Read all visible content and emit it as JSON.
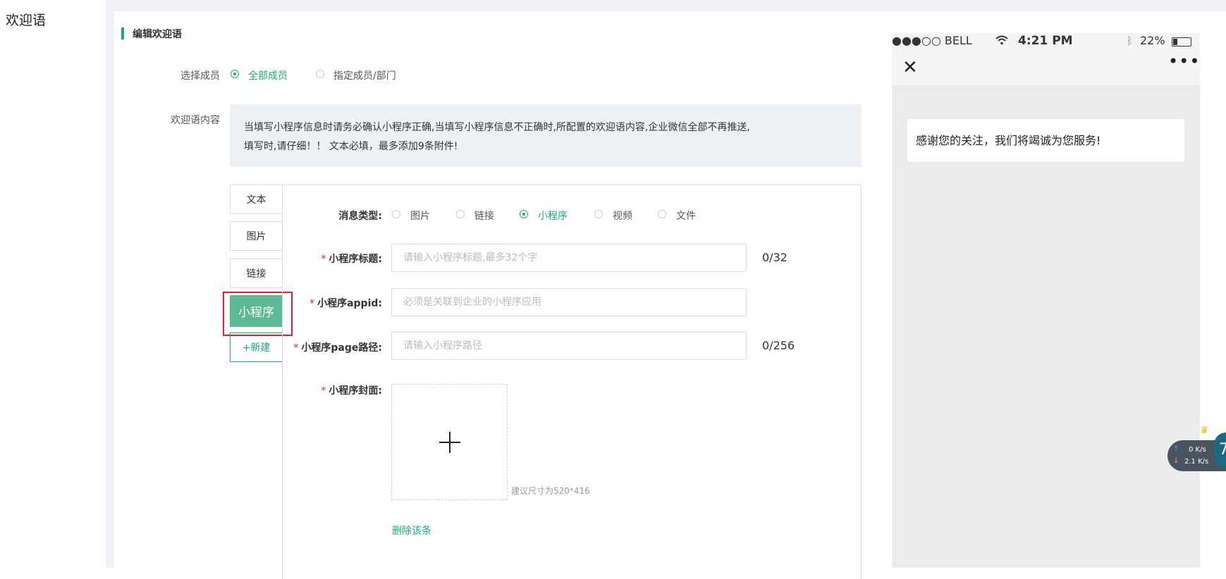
{
  "sidebar": {
    "title": "欢迎语"
  },
  "section": {
    "title": "编辑欢迎语"
  },
  "members": {
    "label": "选择成员",
    "options": [
      {
        "label": "全部成员",
        "selected": true
      },
      {
        "label": "指定成员/部门",
        "selected": false
      }
    ]
  },
  "welcome": {
    "label": "欢迎语内容",
    "notice_line1": "当填写小程序信息时请务必确认小程序正确,当填写小程序信息不正确时,所配置的欢迎语内容,企业微信全部不再推送,",
    "notice_line2": "填写时,请仔细！！ 文本必填，最多添加9条附件!"
  },
  "tabs": [
    {
      "label": "文本",
      "active": false
    },
    {
      "label": "图片",
      "active": false
    },
    {
      "label": "链接",
      "active": false
    },
    {
      "label": "小程序",
      "active": true
    },
    {
      "label": "+新建",
      "active": false
    }
  ],
  "form": {
    "msg_type_label": "消息类型:",
    "msg_types": [
      {
        "label": "图片",
        "selected": false
      },
      {
        "label": "链接",
        "selected": false
      },
      {
        "label": "小程序",
        "selected": true
      },
      {
        "label": "视频",
        "selected": false
      },
      {
        "label": "文件",
        "selected": false
      }
    ],
    "title_label": "小程序标题:",
    "title_placeholder": "请输入小程序标题,最多32个字",
    "title_counter": "0/32",
    "appid_label": "小程序appid:",
    "appid_placeholder": "必须是关联到企业的小程序应用",
    "page_label": "小程序page路径:",
    "page_placeholder": "请输入小程序路径",
    "page_counter": "0/256",
    "cover_label": "小程序封面:",
    "cover_hint": "建议尺寸为520*416",
    "delete_label": "删除该条",
    "required_mark": "*"
  },
  "phone": {
    "carrier": "●●●○○ BELL",
    "time": "4:21 PM",
    "battery": "22%",
    "message": "感谢您的关注，我们将竭诚为您服务!"
  },
  "net_widget": {
    "upload_speed": "0 K/s",
    "download_speed": "2.1 K/s",
    "badge": "7"
  },
  "colors": {
    "accent": "#1aad6e",
    "active_tab": "#5db894",
    "highlight_box": "#e5202e"
  }
}
